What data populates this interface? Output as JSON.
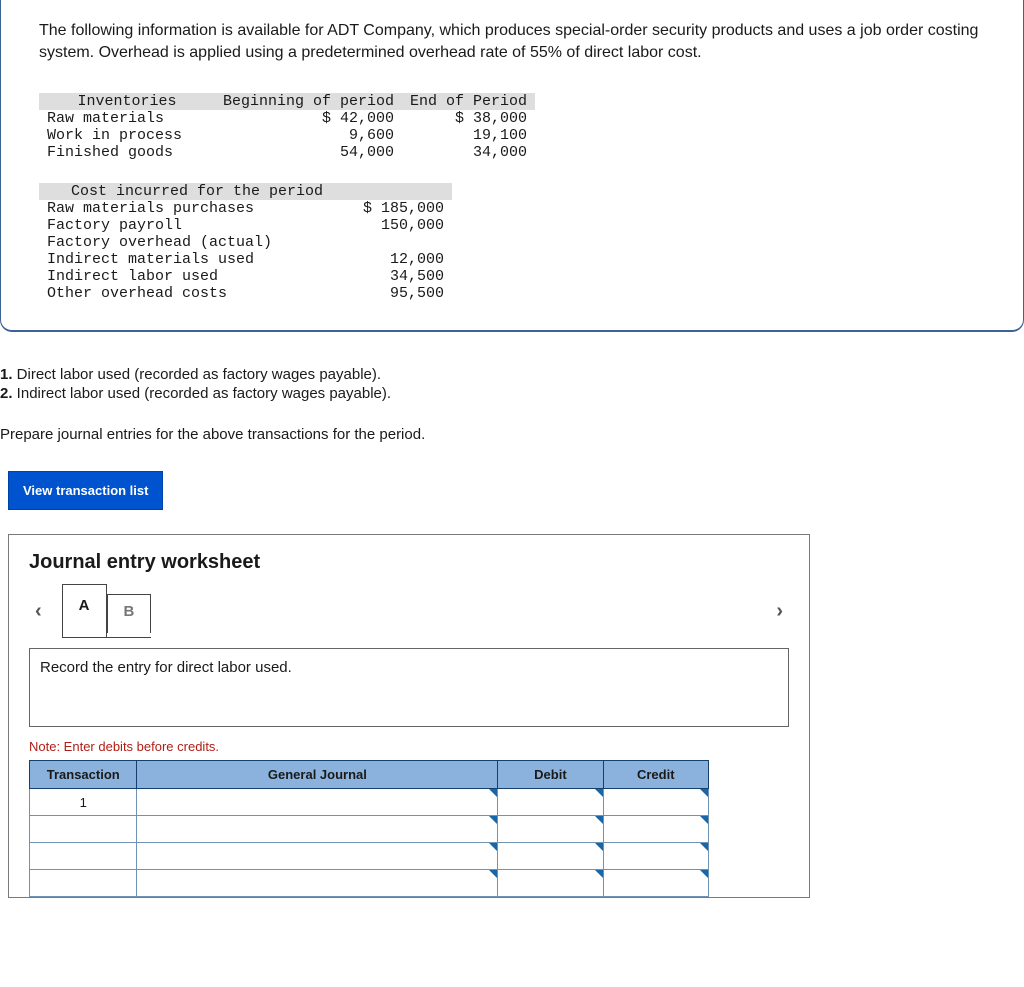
{
  "intro": "The following information is available for ADT Company, which produces special-order security products and uses a job order costing system. Overhead is applied using a predetermined overhead rate of 55% of direct labor cost.",
  "inventories_table": {
    "header": {
      "c0": "Inventories",
      "c1": "Beginning of period",
      "c2": "End of Period"
    },
    "rows": [
      {
        "label": "Raw materials",
        "begin": "$ 42,000",
        "end": "$ 38,000"
      },
      {
        "label": "Work in process",
        "begin": "9,600",
        "end": "19,100"
      },
      {
        "label": "Finished goods",
        "begin": "54,000",
        "end": "34,000"
      }
    ]
  },
  "costs_table": {
    "header": "Cost incurred for the period",
    "rows": [
      {
        "label": "Raw materials purchases",
        "amount": "$ 185,000"
      },
      {
        "label": "Factory payroll",
        "amount": "150,000"
      },
      {
        "label": "Factory overhead (actual)",
        "amount": ""
      },
      {
        "label": "Indirect materials used",
        "amount": "12,000"
      },
      {
        "label": "Indirect labor used",
        "amount": "34,500"
      },
      {
        "label": "Other overhead costs",
        "amount": "95,500"
      }
    ]
  },
  "questions": {
    "q1n": "1.",
    "q1": " Direct labor used (recorded as factory wages payable).",
    "q2n": "2.",
    "q2": " Indirect labor used (recorded as factory wages payable)."
  },
  "instruction": "Prepare journal entries for the above transactions for the period.",
  "button_view": "View transaction list",
  "worksheet": {
    "title": "Journal entry worksheet",
    "tabs": [
      "A",
      "B"
    ],
    "prompt": "Record the entry for direct labor used.",
    "note": "Note: Enter debits before credits.",
    "headers": {
      "txn": "Transaction",
      "gj": "General Journal",
      "debit": "Debit",
      "credit": "Credit"
    },
    "first_txn": "1"
  }
}
